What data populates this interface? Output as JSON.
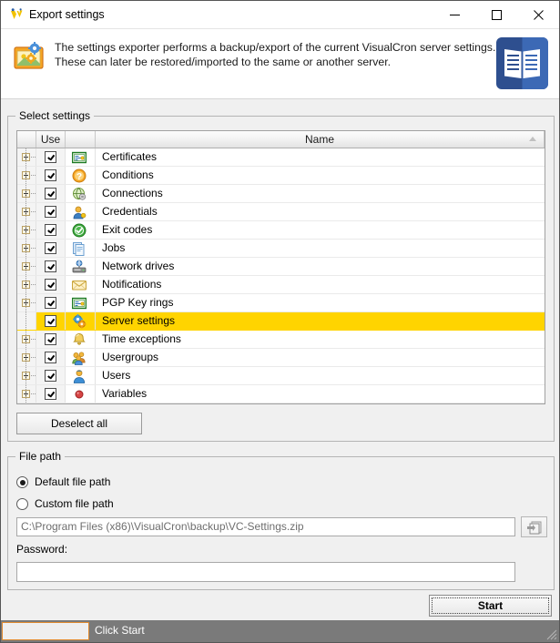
{
  "window": {
    "title": "Export settings",
    "icon": "visualcron-logo-icon",
    "controls": {
      "minimize": "minimize-icon",
      "maximize": "maximize-icon",
      "close": "close-icon"
    }
  },
  "header": {
    "icon": "export-settings-icon",
    "line1": "The settings exporter performs a backup/export of the current VisualCron server settings.",
    "line2": "These can later be restored/imported to the same or another server.",
    "help_icon": "documentation-book-icon"
  },
  "select_settings": {
    "group_title": "Select settings",
    "columns": {
      "use": "Use",
      "icon": "",
      "name": "Name",
      "sort_indicator": "sort-ascending-icon"
    },
    "rows": [
      {
        "name": "Certificates",
        "checked": true,
        "expandable": true,
        "selected": false,
        "icon": "certificate-icon"
      },
      {
        "name": "Conditions",
        "checked": true,
        "expandable": true,
        "selected": false,
        "icon": "question-mark-icon"
      },
      {
        "name": "Connections",
        "checked": true,
        "expandable": true,
        "selected": false,
        "icon": "globe-connection-icon"
      },
      {
        "name": "Credentials",
        "checked": true,
        "expandable": true,
        "selected": false,
        "icon": "user-key-icon"
      },
      {
        "name": "Exit codes",
        "checked": true,
        "expandable": true,
        "selected": false,
        "icon": "green-check-icon"
      },
      {
        "name": "Jobs",
        "checked": true,
        "expandable": true,
        "selected": false,
        "icon": "documents-icon"
      },
      {
        "name": "Network drives",
        "checked": true,
        "expandable": true,
        "selected": false,
        "icon": "network-drive-icon"
      },
      {
        "name": "Notifications",
        "checked": true,
        "expandable": true,
        "selected": false,
        "icon": "envelope-icon"
      },
      {
        "name": "PGP Key rings",
        "checked": true,
        "expandable": true,
        "selected": false,
        "icon": "certificate-icon"
      },
      {
        "name": "Server settings",
        "checked": true,
        "expandable": false,
        "selected": true,
        "icon": "gears-icon"
      },
      {
        "name": "Time exceptions",
        "checked": true,
        "expandable": true,
        "selected": false,
        "icon": "bell-icon"
      },
      {
        "name": "Usergroups",
        "checked": true,
        "expandable": true,
        "selected": false,
        "icon": "usergroup-icon"
      },
      {
        "name": "Users",
        "checked": true,
        "expandable": true,
        "selected": false,
        "icon": "user-icon"
      },
      {
        "name": "Variables",
        "checked": true,
        "expandable": true,
        "selected": false,
        "icon": "red-dot-icon"
      }
    ],
    "deselect_all_label": "Deselect all"
  },
  "file_path": {
    "group_title": "File path",
    "default_option": "Default file path",
    "custom_option": "Custom file path",
    "selected_option": "default",
    "path_value": "C:\\Program Files (x86)\\VisualCron\\backup\\VC-Settings.zip",
    "browse_icon": "browse-folder-icon",
    "password_label": "Password:",
    "password_value": ""
  },
  "actions": {
    "start_label": "Start"
  },
  "status_bar": {
    "message": "Click Start",
    "progress_value": ""
  },
  "colors": {
    "selection_yellow": "#ffd400",
    "status_bar_gray": "#7a7a7a",
    "accent_orange": "#e08a2e",
    "help_blue": "#3d5a98"
  }
}
